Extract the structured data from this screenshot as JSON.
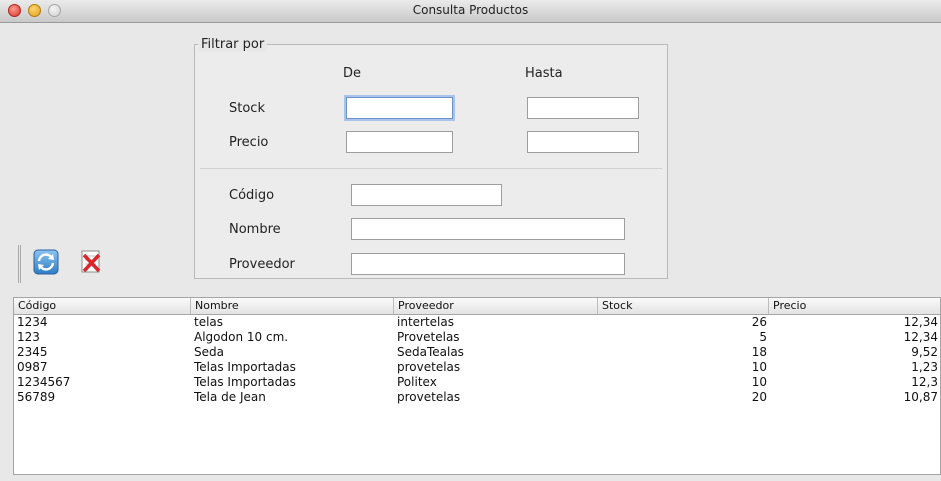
{
  "window": {
    "title": "Consulta Productos"
  },
  "filter": {
    "legend": "Filtrar por",
    "col_from": "De",
    "col_to": "Hasta",
    "stock_label": "Stock",
    "price_label": "Precio",
    "code_label": "Código",
    "name_label": "Nombre",
    "supplier_label": "Proveedor",
    "stock_from": "",
    "stock_to": "",
    "price_from": "",
    "price_to": "",
    "code": "",
    "name": "",
    "supplier": ""
  },
  "toolbar": {
    "refresh_icon": "refresh-icon",
    "clear_icon": "clear-filter-icon"
  },
  "table": {
    "headers": [
      "Código",
      "Nombre",
      "Proveedor",
      "Stock",
      "Precio"
    ],
    "rows": [
      [
        "1234",
        "telas",
        "intertelas",
        "26",
        "12,34"
      ],
      [
        "123",
        "Algodon 10 cm.",
        "Provetelas",
        "5",
        "12,34"
      ],
      [
        "2345",
        "Seda",
        "SedaTealas",
        "18",
        "9,52"
      ],
      [
        "0987",
        "Telas Importadas",
        "provetelas",
        "10",
        "1,23"
      ],
      [
        "1234567",
        "Telas Importadas",
        "Politex",
        "10",
        "12,3"
      ],
      [
        "56789",
        "Tela de Jean",
        "provetelas",
        "20",
        "10,87"
      ]
    ]
  },
  "colors": {
    "accent": "#6c93c9"
  }
}
